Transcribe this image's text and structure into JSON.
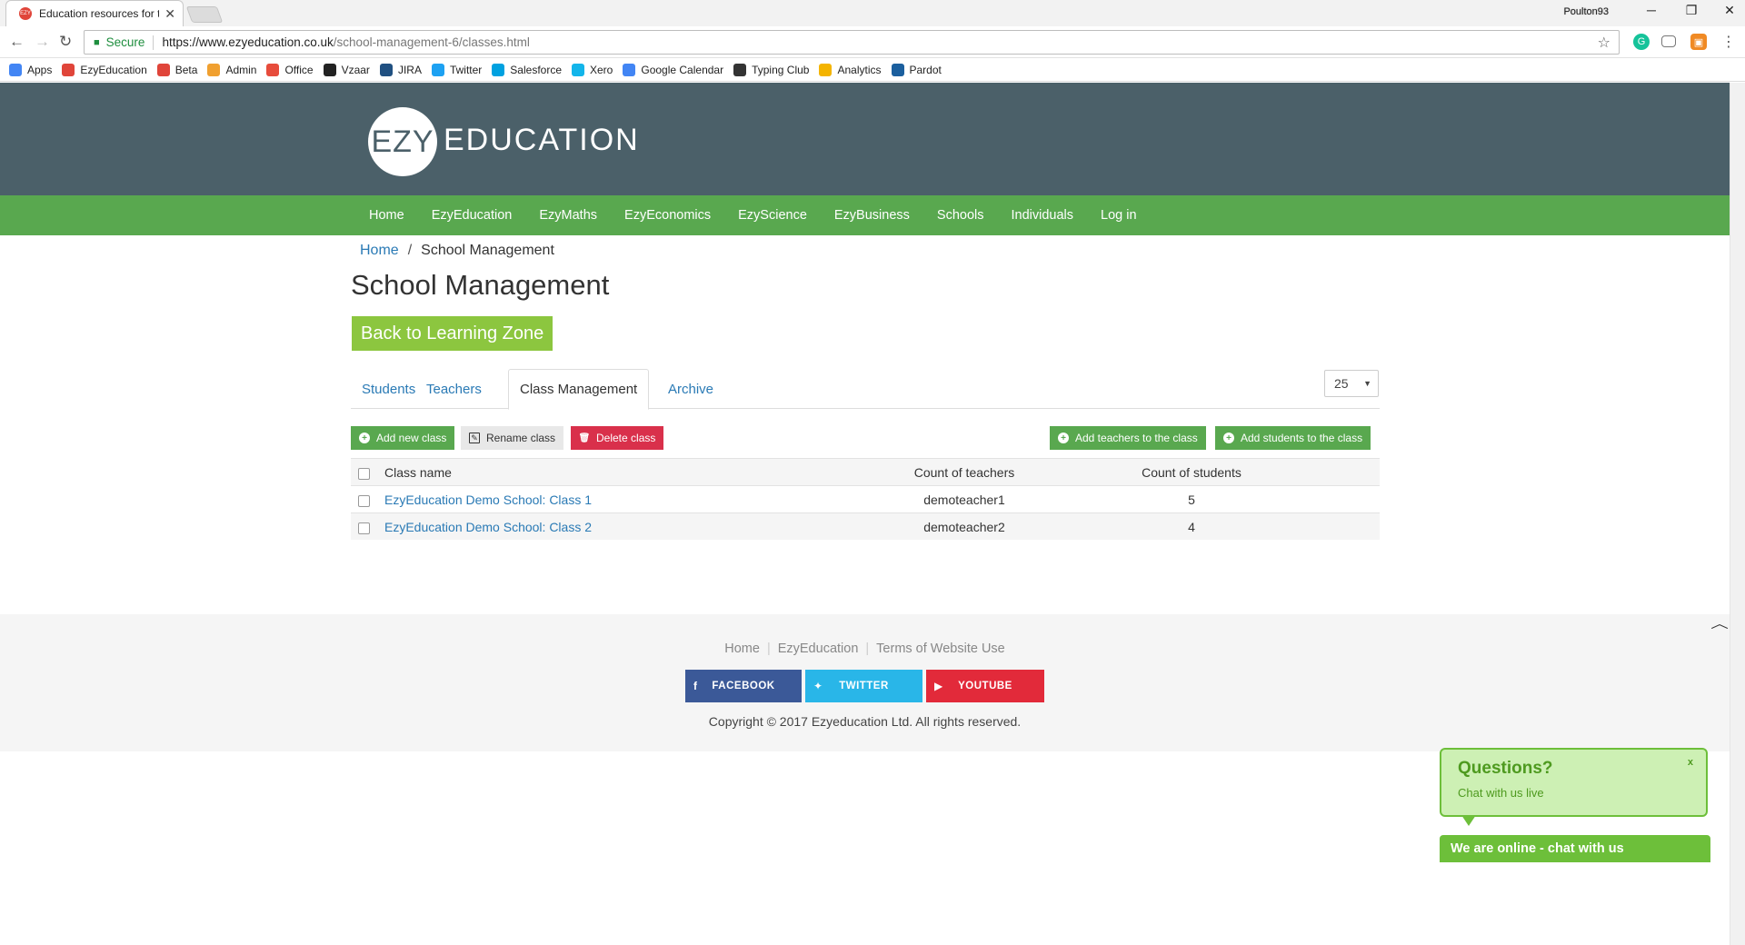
{
  "browser": {
    "tab_title": "Education resources for t",
    "tab_favicon_text": "EZY",
    "profile_name": "Poulton93",
    "secure_label": "Secure",
    "url_host": "https://www.ezyeducation.co.uk",
    "url_path": "/school-management-6/classes.html",
    "bookmarks": [
      {
        "label": "Apps",
        "color": "#4285f4"
      },
      {
        "label": "EzyEducation",
        "color": "#e0453a"
      },
      {
        "label": "Beta",
        "color": "#e0453a"
      },
      {
        "label": "Admin",
        "color": "#f0a030"
      },
      {
        "label": "Office",
        "color": "#e74c3c"
      },
      {
        "label": "Vzaar",
        "color": "#222222"
      },
      {
        "label": "JIRA",
        "color": "#205081"
      },
      {
        "label": "Twitter",
        "color": "#1da1f2"
      },
      {
        "label": "Salesforce",
        "color": "#00a1e0"
      },
      {
        "label": "Xero",
        "color": "#13b5ea"
      },
      {
        "label": "Google Calendar",
        "color": "#4285f4"
      },
      {
        "label": "Typing Club",
        "color": "#333333"
      },
      {
        "label": "Analytics",
        "color": "#f4b400"
      },
      {
        "label": "Pardot",
        "color": "#1b5f9e"
      }
    ]
  },
  "header": {
    "logo_left": "EZY",
    "logo_right": "EDUCATION"
  },
  "nav": [
    "Home",
    "EzyEducation",
    "EzyMaths",
    "EzyEconomics",
    "EzyScience",
    "EzyBusiness",
    "Schools",
    "Individuals",
    "Log in"
  ],
  "breadcrumb": {
    "home": "Home",
    "separator": "/",
    "current": "School Management"
  },
  "page_title": "School Management",
  "back_button": "Back to Learning Zone",
  "tabs": [
    "Students",
    "Teachers",
    "Class Management",
    "Archive"
  ],
  "per_page": "25",
  "actions": {
    "add_class": "Add new class",
    "rename_class": "Rename class",
    "delete_class": "Delete class",
    "add_teachers": "Add teachers to the class",
    "add_students": "Add students to the class"
  },
  "table": {
    "columns": [
      "Class name",
      "Count of teachers",
      "Count of students"
    ],
    "rows": [
      {
        "name": "EzyEducation Demo School: Class 1",
        "teachers": "demoteacher1",
        "students": "5"
      },
      {
        "name": "EzyEducation Demo School: Class 2",
        "teachers": "demoteacher2",
        "students": "4"
      }
    ]
  },
  "footer": {
    "links": [
      "Home",
      "EzyEducation",
      "Terms of Website Use"
    ],
    "social": {
      "facebook": "FACEBOOK",
      "twitter": "TWITTER",
      "youtube": "YOUTUBE"
    },
    "copyright": "Copyright © 2017 Ezyeducation Ltd. All rights reserved."
  },
  "chat": {
    "title": "Questions?",
    "subtitle": "Chat with us live",
    "close": "x",
    "bar": "We are online - chat with us"
  },
  "colors": {
    "header_bg": "#4b6069",
    "nav_green": "#59a84f",
    "button_lime": "#8cc63f",
    "link_blue": "#2a7ab5",
    "delete_red": "#d9304b",
    "facebook": "#3b5998",
    "twitter": "#29b6e8",
    "youtube": "#e22a3a"
  }
}
